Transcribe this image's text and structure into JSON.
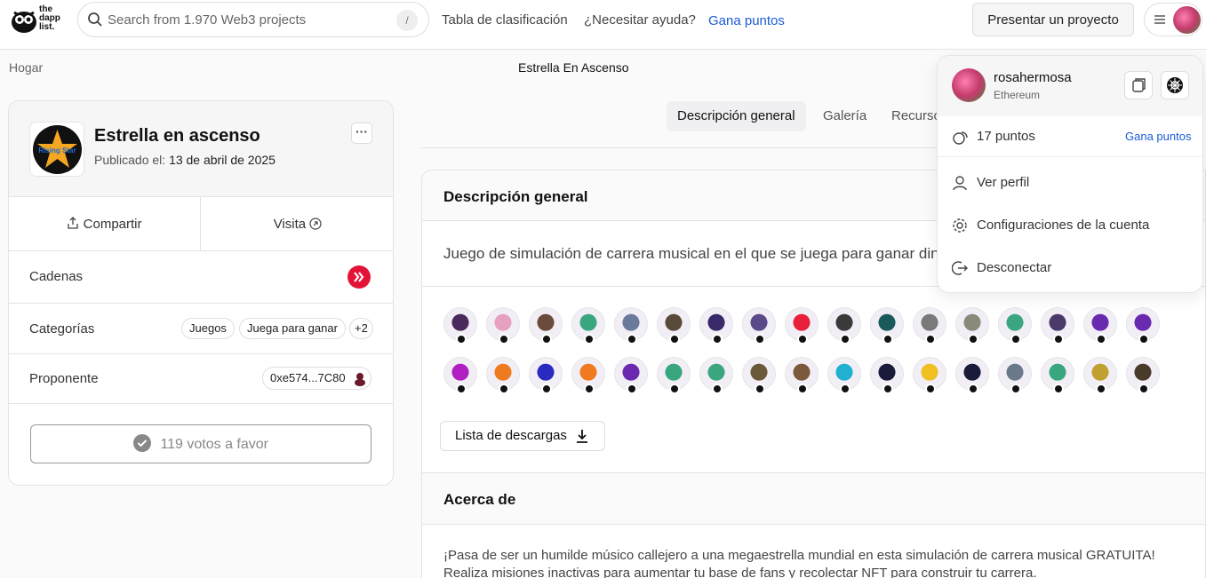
{
  "brand": {
    "logo_text_1": "the",
    "logo_text_2": "dapp",
    "logo_text_3": "list."
  },
  "search": {
    "placeholder": "Search from 1.970 Web3 projects",
    "shortcut": "/"
  },
  "nav": {
    "leaderboard": "Tabla de clasificación",
    "help": "¿Necesitar ayuda?",
    "earn_points": "Gana puntos",
    "submit_project": "Presentar un proyecto"
  },
  "breadcrumb": {
    "home": "Hogar",
    "current": "Estrella En Ascenso"
  },
  "project": {
    "name": "Estrella en ascenso",
    "published_label": "Publicado el:",
    "published_date": "13 de abril de 2025",
    "logo_text": "Rising Star",
    "share_label": "Compartir",
    "visit_label": "Visita",
    "chains_label": "Cadenas",
    "categories_label": "Categorías",
    "categories": [
      "Juegos",
      "Juega para ganar",
      "+2"
    ],
    "proposer_label": "Proponente",
    "proposer_address": "0xe574...7C80",
    "votes_label": "119 votos a favor"
  },
  "tabs": [
    "Descripción general",
    "Galería",
    "Recursos"
  ],
  "overview": {
    "title": "Descripción general",
    "description": "Juego de simulación de carrera musical en el que se juega para ganar dinero",
    "download_list": "Lista de descargas"
  },
  "about": {
    "title": "Acerca de",
    "line1": "¡Pasa de ser un humilde músico callejero a una megaestrella mundial en esta simulación de carrera musical GRATUITA!",
    "line2": "Realiza misiones inactivas para aumentar tu base de fans y recolectar NFT para construir tu carrera."
  },
  "voters_row1": [
    "#4a2a5a",
    "#e8a0c0",
    "#6a4a3a",
    "#3aa680",
    "#6a7a9a",
    "#5a4a3a",
    "#3a2a6a",
    "#5a4a8a",
    "#e8203a",
    "#3a3a3a",
    "#1a5a5a",
    "#7a7a7a",
    "#8a8a7a",
    "#3aa680",
    "#4a3a6a",
    "#6a2ab0",
    "#6a2ab0"
  ],
  "voters_row2": [
    "#b020c0",
    "#f07a20",
    "#2a2ac0",
    "#f07a20",
    "#6a2ab0",
    "#3aa680",
    "#3aa680",
    "#6a5a3a",
    "#7a5a3a",
    "#20b0d0",
    "#1a1a3a",
    "#f0c020",
    "#1a1a3a",
    "#6a7a8a",
    "#3aa680",
    "#c0a030",
    "#4a3a2a"
  ],
  "dropdown": {
    "username": "rosahermosa",
    "network": "Ethereum",
    "points": "17 puntos",
    "earn_points": "Gana puntos",
    "view_profile": "Ver perfil",
    "settings": "Configuraciones de la cuenta",
    "logout": "Desconectar"
  }
}
